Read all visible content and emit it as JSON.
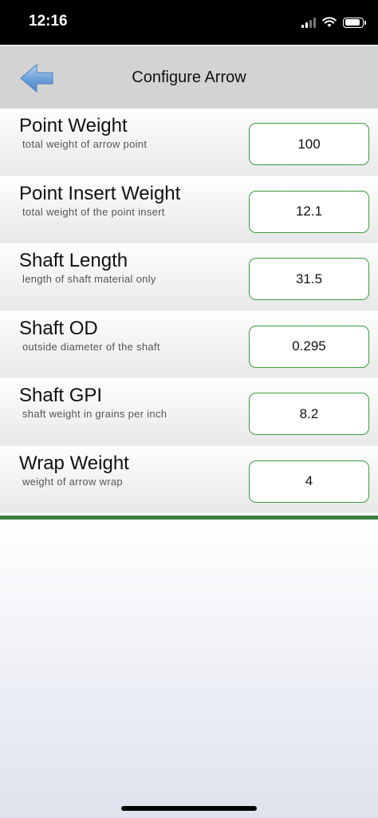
{
  "status": {
    "time": "12:16"
  },
  "nav": {
    "title": "Configure Arrow",
    "back_icon": "back-arrow-icon"
  },
  "colors": {
    "accent_border": "#3d9b3d",
    "divider": "#3f7f3f",
    "nav_background": "#d3d3d3"
  },
  "fields": [
    {
      "label": "Point Weight",
      "description": "total weight of arrow point",
      "value": "100"
    },
    {
      "label": "Point Insert Weight",
      "description": "total weight of the point insert",
      "value": "12.1"
    },
    {
      "label": "Shaft Length",
      "description": "length of shaft material only",
      "value": "31.5"
    },
    {
      "label": "Shaft OD",
      "description": "outside diameter of the shaft",
      "value": "0.295"
    },
    {
      "label": "Shaft GPI",
      "description": "shaft weight in grains per inch",
      "value": "8.2"
    },
    {
      "label": "Wrap Weight",
      "description": "weight of arrow wrap",
      "value": "4"
    }
  ]
}
